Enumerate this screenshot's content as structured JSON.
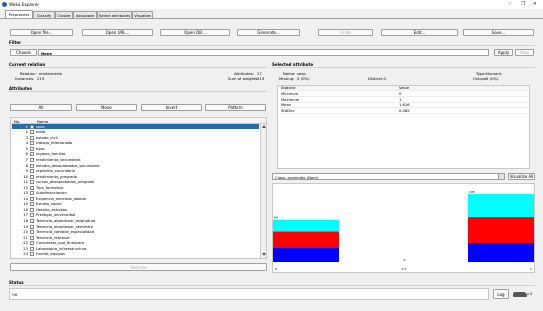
{
  "window": {
    "title": "Weka Explorer",
    "min_symbol": "–",
    "max_symbol": "❐",
    "close_symbol": "✕"
  },
  "tabs": [
    {
      "label": "Preprocess",
      "active": true
    },
    {
      "label": "Classify"
    },
    {
      "label": "Cluster"
    },
    {
      "label": "Associate"
    },
    {
      "label": "Select attributes"
    },
    {
      "label": "Visualize"
    }
  ],
  "toolbar": {
    "open_file": "Open file...",
    "open_url": "Open URL...",
    "open_db": "Open DB...",
    "generate": "Generate...",
    "undo": "Undo",
    "edit": "Edit...",
    "save": "Save..."
  },
  "filter": {
    "section_label": "Filter",
    "choose_button": "Choose",
    "value": "None",
    "apply_button": "Apply",
    "stop_button": "Stop"
  },
  "current_relation": {
    "section_label": "Current relation",
    "relation_label": "Relation:",
    "relation_value": "emdiemerte",
    "instances_label": "Instances:",
    "instances_value": "219",
    "attributes_label": "Attributes:",
    "attributes_value": "27",
    "sum_weights_label": "Sum of weights:",
    "sum_weights_value": "219"
  },
  "attributes": {
    "section_label": "Attributes",
    "all_button": "All",
    "none_button": "None",
    "invert_button": "Invert",
    "pattern_button": "Pattern",
    "col_no": "No.",
    "col_name": "Name",
    "remove_button": "Remove",
    "items": [
      {
        "no": "1",
        "name": "sexo"
      },
      {
        "no": "2",
        "name": "edad"
      },
      {
        "no": "3",
        "name": "estado_civil"
      },
      {
        "no": "4",
        "name": "trabajo_relacionado"
      },
      {
        "no": "5",
        "name": "hijos"
      },
      {
        "no": "6",
        "name": "ingreso_familiar"
      },
      {
        "no": "7",
        "name": "rendimiento_secundaria"
      },
      {
        "no": "8",
        "name": "estudio_desaprobados_secundaria"
      },
      {
        "no": "9",
        "name": "repitente_secundaria"
      },
      {
        "no": "10",
        "name": "rendimiento_pregrado"
      },
      {
        "no": "11",
        "name": "cursos_desaprobados_pregrado"
      },
      {
        "no": "12",
        "name": "Tipo_formativo"
      },
      {
        "no": "13",
        "name": "Autofinanciacion"
      },
      {
        "no": "14",
        "name": "Exigencia_mercado_laboral"
      },
      {
        "no": "15",
        "name": "Estrato_social"
      },
      {
        "no": "16",
        "name": "Horario_estudios"
      },
      {
        "no": "17",
        "name": "Prestigio_universidad"
      },
      {
        "no": "18",
        "name": "Tenencia_abandonar_asignatura"
      },
      {
        "no": "19",
        "name": "Tenencia_abandonar_semestre"
      },
      {
        "no": "20",
        "name": "Tenencia_cambiar_especialidad"
      },
      {
        "no": "21",
        "name": "Tenencia_retirarse"
      },
      {
        "no": "22",
        "name": "Consideras_que_finalizara"
      },
      {
        "no": "23",
        "name": "Laboratorio_infraestructura"
      },
      {
        "no": "24",
        "name": "Fuente_equipos"
      }
    ]
  },
  "selected_attribute": {
    "section_label": "Selected attribute",
    "name_label": "Name:",
    "name_value": "sexo",
    "missing_label": "Missing:",
    "missing_value": "0 (0%)",
    "distinct_label": "Distinct:",
    "distinct_value": "2",
    "type_label": "Type:",
    "type_value": "Numeric",
    "unique_label": "Unique:",
    "unique_value": "0 (0%)",
    "stats_header": {
      "statistic": "Statistic",
      "value": "Value"
    },
    "stats": [
      {
        "statistic": "Minimum",
        "value": "0"
      },
      {
        "statistic": "Maximum",
        "value": "1"
      },
      {
        "statistic": "Mean",
        "value": "1.616"
      },
      {
        "statistic": "StdDev",
        "value": "0.485"
      }
    ]
  },
  "class_selector": {
    "value": "Class: promedio (Nom)",
    "visualize_all_button": "Visualize All"
  },
  "histogram": {
    "bars": [
      {
        "count_label": "84",
        "total": 84,
        "segments": [
          0.28,
          0.38,
          0.34
        ]
      },
      {
        "count_label": "0",
        "total": 0,
        "segments": []
      },
      {
        "count_label": "135",
        "total": 135,
        "segments": [
          0.34,
          0.38,
          0.28
        ]
      }
    ],
    "colors": [
      "#00ffff",
      "#ff0000",
      "#0000ff"
    ],
    "axis_left": "0",
    "axis_mid": "0.5",
    "axis_right": "1"
  },
  "status": {
    "section_label": "Status",
    "text": "OK",
    "log_button": "Log",
    "x_label": "x 0"
  }
}
